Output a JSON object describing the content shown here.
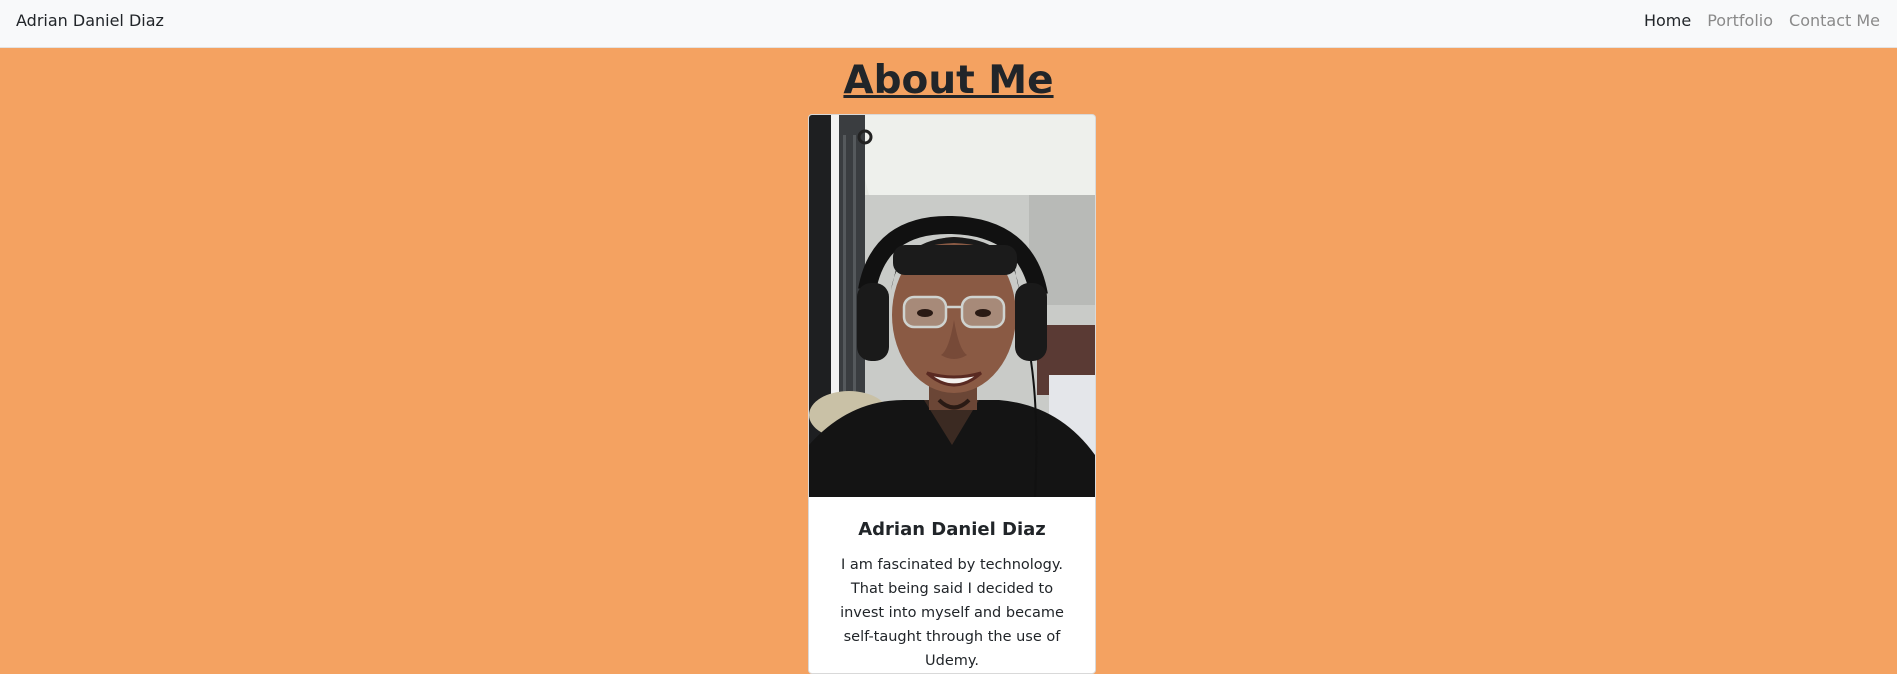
{
  "navbar": {
    "brand": "Adrian Daniel Diaz",
    "links": [
      {
        "label": "Home",
        "active": true
      },
      {
        "label": "Portfolio",
        "active": false
      },
      {
        "label": "Contact Me",
        "active": false
      }
    ]
  },
  "main": {
    "heading": "About Me",
    "card": {
      "photo_icon": "profile-photo",
      "title": "Adrian Daniel Diaz",
      "text": "I am fascinated by technology. That being said I decided to invest into myself and became self-taught through the use of Udemy."
    }
  },
  "colors": {
    "background": "#f4a261",
    "navbar": "#f8f9fa",
    "text": "#212529",
    "nav_inactive": "#8a8a8a"
  }
}
